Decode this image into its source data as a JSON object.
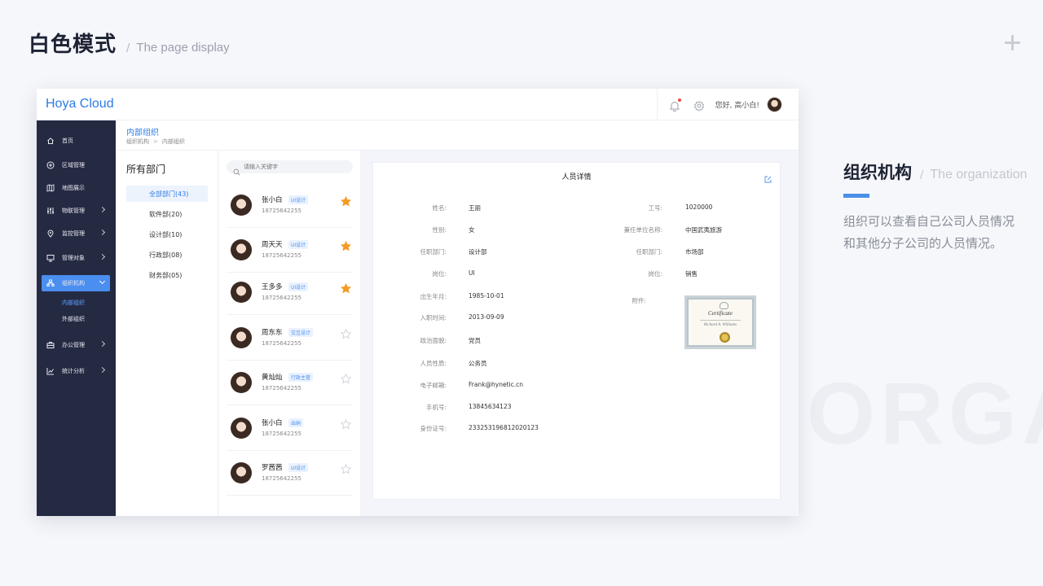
{
  "slide": {
    "title_zh": "白色模式",
    "separator": "/",
    "title_en": "The page display",
    "watermark": "ORGA",
    "section": {
      "title_zh": "组织机构",
      "separator": "/",
      "title_en": "The organization",
      "description": "组织可以查看自己公司人员情况和其他分子公司的人员情况。"
    }
  },
  "app": {
    "logo": "Hoya Cloud",
    "greeting": "您好, 高小白!",
    "sidebar": {
      "items": [
        {
          "label": "首页",
          "icon": "home-icon"
        },
        {
          "label": "区域管理",
          "icon": "plus-circle-icon"
        },
        {
          "label": "地图展示",
          "icon": "map-icon"
        },
        {
          "label": "物联管理",
          "icon": "sliders-icon"
        },
        {
          "label": "监控管理",
          "icon": "location-icon"
        },
        {
          "label": "管理对象",
          "icon": "monitor-icon"
        },
        {
          "label": "组织机构",
          "icon": "org-icon"
        },
        {
          "label": "办公管理",
          "icon": "briefcase-icon"
        },
        {
          "label": "统计分析",
          "icon": "chart-icon"
        }
      ],
      "active_index": 6,
      "sub_items": [
        {
          "label": "内部组织",
          "active": true
        },
        {
          "label": "外部组织",
          "active": false
        }
      ]
    },
    "content_title": "内部组织",
    "breadcrumb": [
      "组织机构",
      "内部组织"
    ],
    "departments": {
      "title": "所有部门",
      "items": [
        {
          "label": "全部部门(43)",
          "active": true
        },
        {
          "label": "软件部(20)",
          "active": false
        },
        {
          "label": "设计部(10)",
          "active": false
        },
        {
          "label": "行政部(08)",
          "active": false
        },
        {
          "label": "财务部(05)",
          "active": false
        }
      ]
    },
    "search": {
      "placeholder": "请输入关键字"
    },
    "people": [
      {
        "name": "张小白",
        "tag": "UI设计",
        "phone": "18725642255",
        "starred": true
      },
      {
        "name": "周天天",
        "tag": "UI设计",
        "phone": "18725642255",
        "starred": true
      },
      {
        "name": "王多多",
        "tag": "UI设计",
        "phone": "18725642255",
        "starred": true
      },
      {
        "name": "周东东",
        "tag": "交互设计",
        "phone": "18725642255",
        "starred": false
      },
      {
        "name": "黄灿灿",
        "tag": "行政主管",
        "phone": "18725642255",
        "starred": false
      },
      {
        "name": "张小白",
        "tag": "出纳",
        "phone": "18725642255",
        "starred": false
      },
      {
        "name": "罗茜茜",
        "tag": "UI设计",
        "phone": "18725642255",
        "starred": false
      }
    ],
    "detail": {
      "title": "人员详情",
      "left": [
        {
          "label": "姓名:",
          "value": "王丽"
        },
        {
          "label": "性别:",
          "value": "女"
        },
        {
          "label": "任职部门:",
          "value": "设计部"
        },
        {
          "label": "岗位:",
          "value": "UI"
        },
        {
          "label": "出生年月:",
          "value": "1985-10-01"
        },
        {
          "label": "入职时间:",
          "value": "2013-09-09"
        },
        {
          "label": "政治面貌:",
          "value": "党员"
        },
        {
          "label": "人员性质:",
          "value": "公务员"
        },
        {
          "label": "电子邮箱:",
          "value": "Frank@hynetic.cn"
        },
        {
          "label": "手机号:",
          "value": "13845634123"
        },
        {
          "label": "身份证号:",
          "value": "233253196812020123"
        }
      ],
      "right": [
        {
          "label": "工号:",
          "value": "1020000"
        },
        {
          "label": "兼任单位名称:",
          "value": "中国武夷旅游"
        },
        {
          "label": "任职部门:",
          "value": "市场部"
        },
        {
          "label": "岗位:",
          "value": "销售"
        }
      ],
      "attachment_label": "附件:",
      "certificate": {
        "title": "Certificate",
        "signature": "Richard A. Williams"
      }
    },
    "colors": {
      "accent": "#2c7be5",
      "sidebar": "#252a43",
      "star": "#f59a23"
    }
  }
}
